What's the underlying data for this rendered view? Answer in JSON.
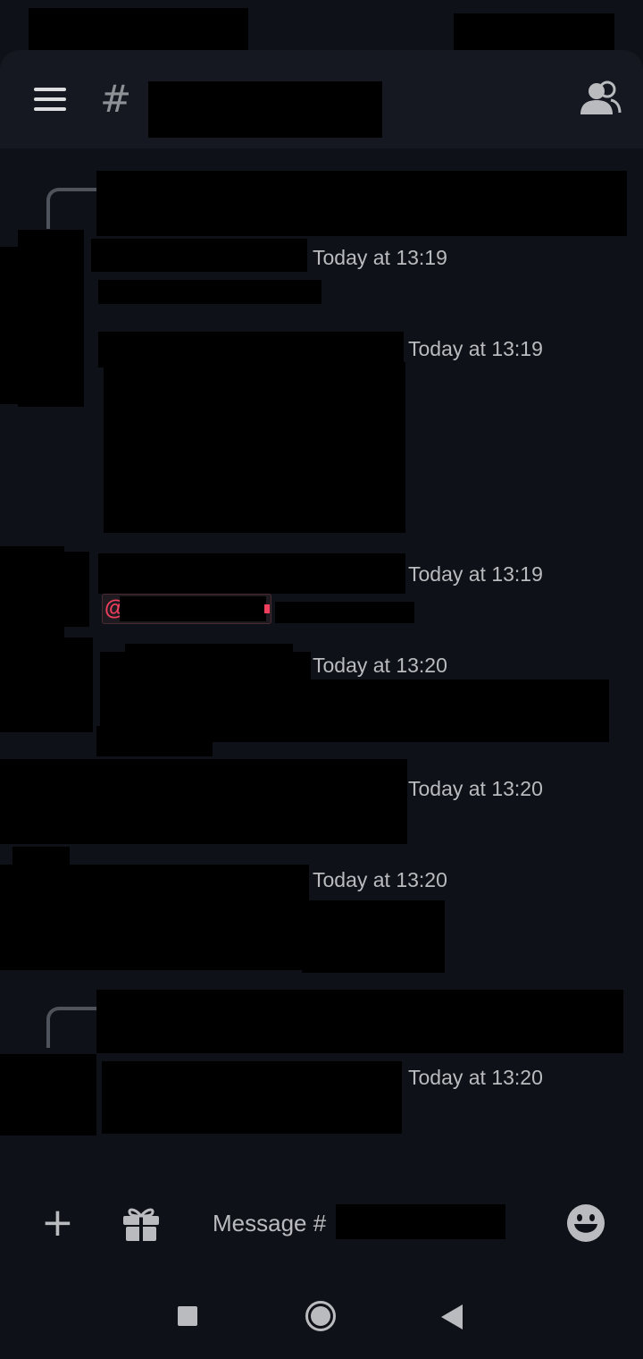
{
  "header": {
    "channel_hash": "#"
  },
  "messages": [
    {
      "timestamp": "Today at 13:19"
    },
    {
      "timestamp": "Today at 13:19"
    },
    {
      "timestamp": "Today at 13:19",
      "mention_symbol": "@"
    },
    {
      "timestamp": "Today at 13:20"
    },
    {
      "timestamp": "Today at 13:20"
    },
    {
      "timestamp": "Today at 13:20"
    },
    {
      "timestamp": "Today at 13:20"
    }
  ],
  "composer": {
    "add_label": "+",
    "placeholder": "Message #"
  },
  "icons": {
    "menu": "hamburger-icon",
    "members": "members-icon",
    "gift": "gift-icon",
    "emoji": "emoji-icon",
    "nav_recent": "square-icon",
    "nav_home": "circle-icon",
    "nav_back": "triangle-icon"
  },
  "colors": {
    "background": "#0f1118",
    "header": "#151821",
    "mention": "#f23f5e"
  }
}
